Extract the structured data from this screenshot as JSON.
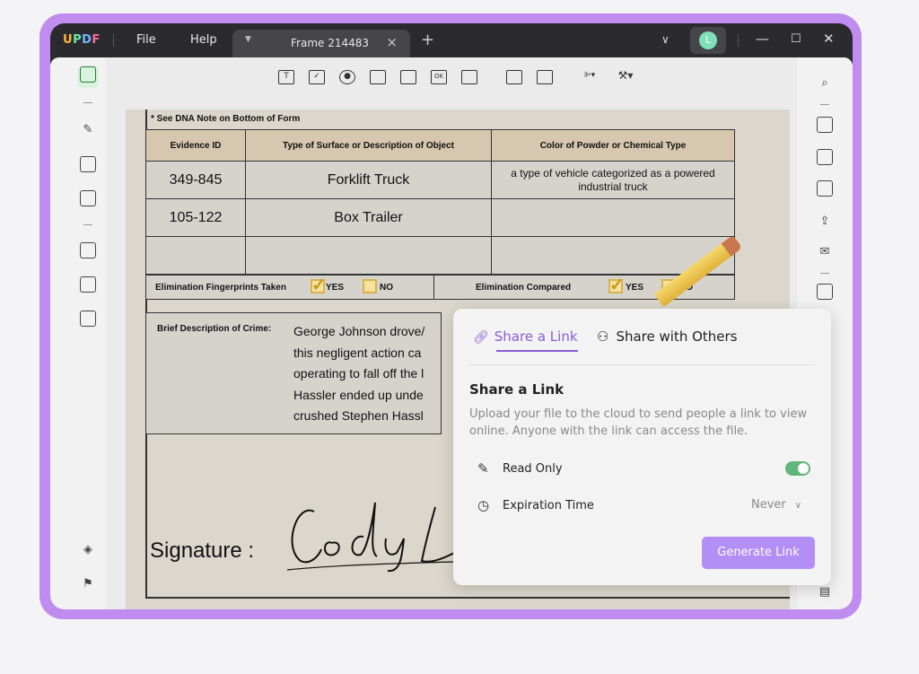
{
  "app": {
    "logo": "UPDF",
    "menu": [
      "File",
      "Help"
    ],
    "tab_title": "Frame 214483",
    "user_initial": "L"
  },
  "document": {
    "note": "* See DNA Note on Bottom of Form",
    "table_headers": [
      "Evidence ID",
      "Type of Surface or Description of Object",
      "Color of Powder or Chemical Type"
    ],
    "rows": [
      [
        "349-845",
        "Forklift Truck",
        "a type of vehicle categorized as a powered industrial truck"
      ],
      [
        "105-122",
        "Box Trailer",
        ""
      ],
      [
        "",
        "",
        ""
      ]
    ],
    "elimination_fingerprints_label": "Elimination Fingerprints Taken",
    "elimination_compared_label": "Elimination Compared",
    "yes": "YES",
    "no": "NO",
    "crime_label": "Brief Description of Crime:",
    "crime_lines": [
      "George Johnson drove/",
      "this negligent action ca",
      "operating to fall off the l",
      "Hassler ended up unde",
      "crushed Stephen Hassl"
    ],
    "signature_label": "Signature :",
    "signature_text": "Cody L"
  },
  "share_popup": {
    "tab_share_link": "Share a Link",
    "tab_share_others": "Share with Others",
    "title": "Share a Link",
    "description": "Upload your file to the cloud to send people a link to view online. Anyone with the link can access the file.",
    "read_only_label": "Read Only",
    "read_only_enabled": true,
    "expiration_label": "Expiration Time",
    "expiration_value": "Never",
    "generate_button": "Generate Link"
  },
  "colors": {
    "accent": "#8a5cd6",
    "button": "#b38ef5",
    "toggle_on": "#5fb57a",
    "frame": "#c18cf0"
  }
}
